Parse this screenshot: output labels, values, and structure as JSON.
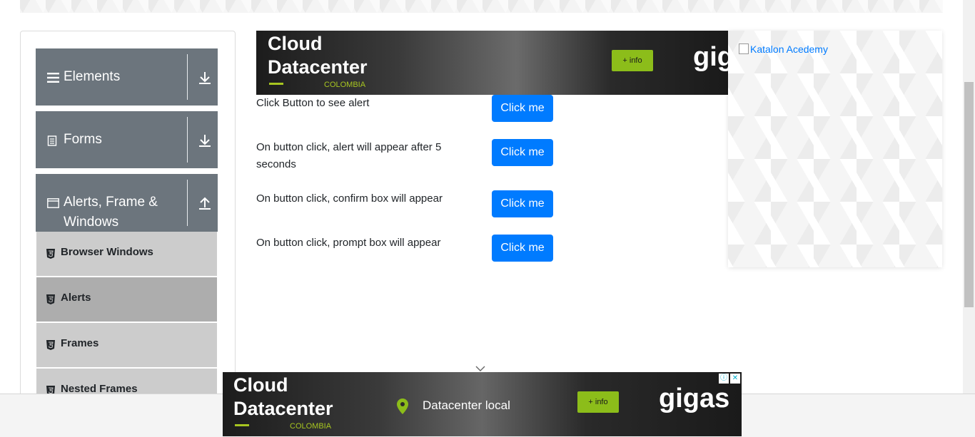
{
  "sidebar": {
    "groups": [
      {
        "label": "Elements",
        "icon": "hamburger-icon",
        "expanded": false
      },
      {
        "label": "Forms",
        "icon": "document-icon",
        "expanded": false
      },
      {
        "label": "Alerts, Frame &",
        "label2": "Windows",
        "icon": "window-icon",
        "expanded": true
      }
    ],
    "items": [
      {
        "label": "Browser Windows",
        "active": false
      },
      {
        "label": "Alerts",
        "active": true
      },
      {
        "label": "Frames",
        "active": false
      },
      {
        "label": "Nested Frames",
        "active": false
      }
    ]
  },
  "ad_top": {
    "line1": "Cloud",
    "line2": "Datacenter",
    "country": "COLOMBIA",
    "info": "+ info",
    "brand": "gig"
  },
  "alerts": [
    {
      "text": "Click Button to see alert",
      "button": "Click me"
    },
    {
      "text": "On button click, alert will appear after 5 seconds",
      "button": "Click me"
    },
    {
      "text": "On button click, confirm box will appear",
      "button": "Click me"
    },
    {
      "text": "On button click, prompt box will appear",
      "button": "Click me"
    }
  ],
  "ad_right": {
    "alt": "Katalon Acedemy"
  },
  "ad_bottom": {
    "line1": "Cloud",
    "line2": "Datacenter",
    "country": "COLOMBIA",
    "location": "Datacenter local",
    "info": "+ info",
    "brand": "gigas"
  },
  "colors": {
    "primary": "#007bff",
    "sidebar_header": "#6c757d",
    "menu_item": "#cccccc",
    "menu_item_active": "#adadad",
    "ad_accent": "#8cbd1a"
  }
}
